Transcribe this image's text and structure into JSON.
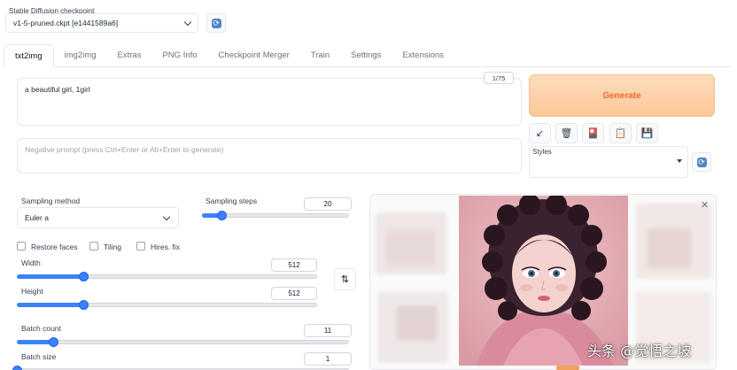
{
  "checkpoint": {
    "label": "Stable Diffusion checkpoint",
    "value": "v1-5-pruned.ckpt [e1441589a6]"
  },
  "tabs": [
    {
      "label": "txt2img",
      "active": true
    },
    {
      "label": "img2img"
    },
    {
      "label": "Extras"
    },
    {
      "label": "PNG Info"
    },
    {
      "label": "Checkpoint Merger"
    },
    {
      "label": "Train"
    },
    {
      "label": "Settings"
    },
    {
      "label": "Extensions"
    }
  ],
  "prompt": {
    "value": "a beautiful girl, 1girl",
    "token_count": "1/75"
  },
  "negative_prompt": {
    "placeholder": "Negative prompt (press Ctrl+Enter or Alt+Enter to generate)"
  },
  "generate": {
    "label": "Generate"
  },
  "toolbar": {
    "icons": [
      "arrow-down-left-icon",
      "trash-icon",
      "card-icon",
      "clipboard-icon",
      "save-icon"
    ],
    "glyphs": [
      "↙",
      "🗑",
      "🎴",
      "📋",
      "💾"
    ]
  },
  "styles": {
    "label": "Styles"
  },
  "sampling_method": {
    "label": "Sampling method",
    "value": "Euler a"
  },
  "sampling_steps": {
    "label": "Sampling steps",
    "value": "20",
    "fraction": 0.13
  },
  "options": {
    "restore_faces": "Restore faces",
    "tiling": "Tiling",
    "hires_fix": "Hires. fix"
  },
  "width": {
    "label": "Width",
    "value": "512",
    "fraction": 0.22
  },
  "height": {
    "label": "Height",
    "value": "512",
    "fraction": 0.22
  },
  "batch_count": {
    "label": "Batch count",
    "value": "11",
    "fraction": 0.11
  },
  "batch_size": {
    "label": "Batch size",
    "value": "1",
    "fraction": 0.0
  },
  "watermark": "头条 @觉悟之坡",
  "colors": {
    "accent": "#3b82f6",
    "generate": "#ea6a2d",
    "refresh": "#4a86c5"
  }
}
